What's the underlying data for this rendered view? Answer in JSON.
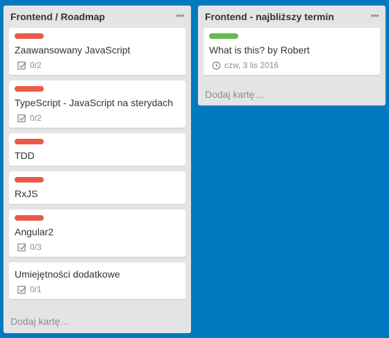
{
  "lists": [
    {
      "title": "Frontend / Roadmap",
      "menu_icon": "ellipsis-icon",
      "add_card": "Dodaj kartę…",
      "cards": [
        {
          "title": "Zaawansowany JavaScript",
          "label_color": "#eb5a46",
          "checklist": "0/2"
        },
        {
          "title": "TypeScript - JavaScript na sterydach",
          "label_color": "#eb5a46",
          "checklist": "0/2"
        },
        {
          "title": "TDD",
          "label_color": "#eb5a46"
        },
        {
          "title": "RxJS",
          "label_color": "#eb5a46"
        },
        {
          "title": "Angular2",
          "label_color": "#eb5a46",
          "checklist": "0/3"
        },
        {
          "title": "Umiejętności dodatkowe",
          "checklist": "0/1"
        }
      ]
    },
    {
      "title": "Frontend - najbliższy termin",
      "menu_icon": "ellipsis-icon",
      "add_card": "Dodaj kartę…",
      "cards": [
        {
          "title": "What is this? by Robert",
          "label_color": "#61bd4f",
          "due": "czw, 3 lis 2016"
        }
      ]
    }
  ],
  "colors": {
    "board_background": "#0079bf",
    "list_background": "#e2e4e6"
  }
}
